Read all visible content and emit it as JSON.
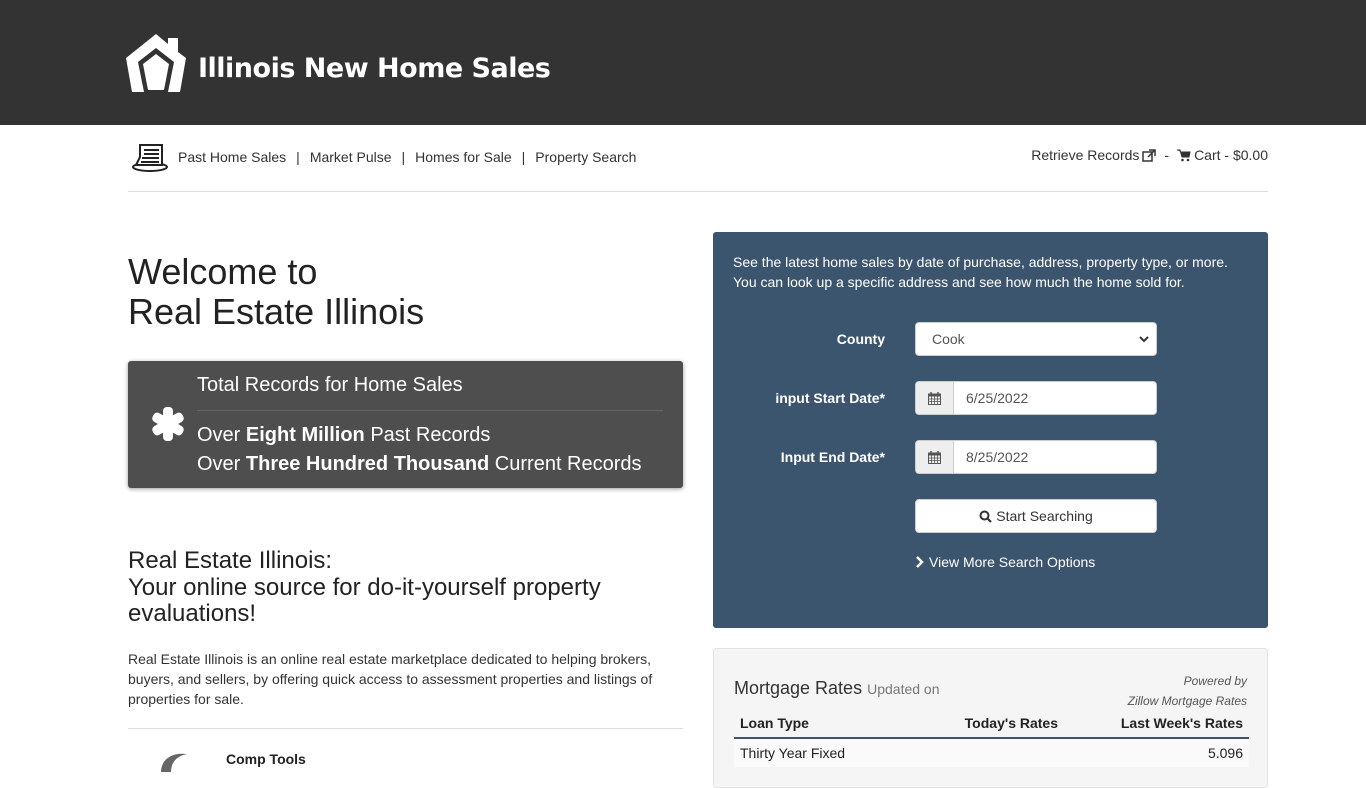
{
  "header": {
    "site_title": "Illinois New Home Sales"
  },
  "nav": {
    "links": [
      {
        "label": "Past Home Sales"
      },
      {
        "label": "Market Pulse"
      },
      {
        "label": "Homes for Sale"
      },
      {
        "label": "Property Search"
      }
    ],
    "separator": "|",
    "retrieve_records": "Retrieve Records",
    "dash": "-",
    "cart": "Cart - $0.00"
  },
  "welcome": {
    "line1": "Welcome to",
    "line2": "Real Estate Illinois"
  },
  "records_box": {
    "title": "Total Records for Home Sales",
    "line1_pre": "Over ",
    "line1_bold": "Eight Million",
    "line1_post": " Past Records",
    "line2_pre": "Over ",
    "line2_bold": "Three Hundred Thousand",
    "line2_post": " Current Records"
  },
  "tagline": {
    "line1": "Real Estate Illinois:",
    "line2": "Your online source for do-it-yourself property evaluations!"
  },
  "about": {
    "text": "Real Estate Illinois is an online real estate marketplace dedicated to helping brokers, buyers, and sellers, by offering quick access to assessment properties and listings of properties for sale."
  },
  "comp_tools": {
    "title": "Comp Tools"
  },
  "search": {
    "intro_line1": "See the latest home sales by date of purchase, address, property type, or more.",
    "intro_line2": "You can look up a specific address and see how much the home sold for.",
    "county_label": "County",
    "county_value": "Cook",
    "start_label": "input Start Date*",
    "start_value": "6/25/2022",
    "end_label": "Input End Date*",
    "end_value": "8/25/2022",
    "button_label": "Start Searching",
    "more_options": "View More Search Options"
  },
  "mortgage": {
    "title": "Mortgage Rates",
    "updated": "Updated on",
    "powered_by": "Powered by",
    "powered_source": "Zillow Mortgage Rates",
    "columns": [
      "Loan Type",
      "Today's Rates",
      "Last Week's Rates"
    ],
    "rows": [
      {
        "loan_type": "Thirty Year Fixed",
        "today": "",
        "last_week": "5.096"
      }
    ]
  },
  "colors": {
    "header_bg": "#333333",
    "search_panel_bg": "#3c556e",
    "records_bg": "#4e4e4e"
  }
}
